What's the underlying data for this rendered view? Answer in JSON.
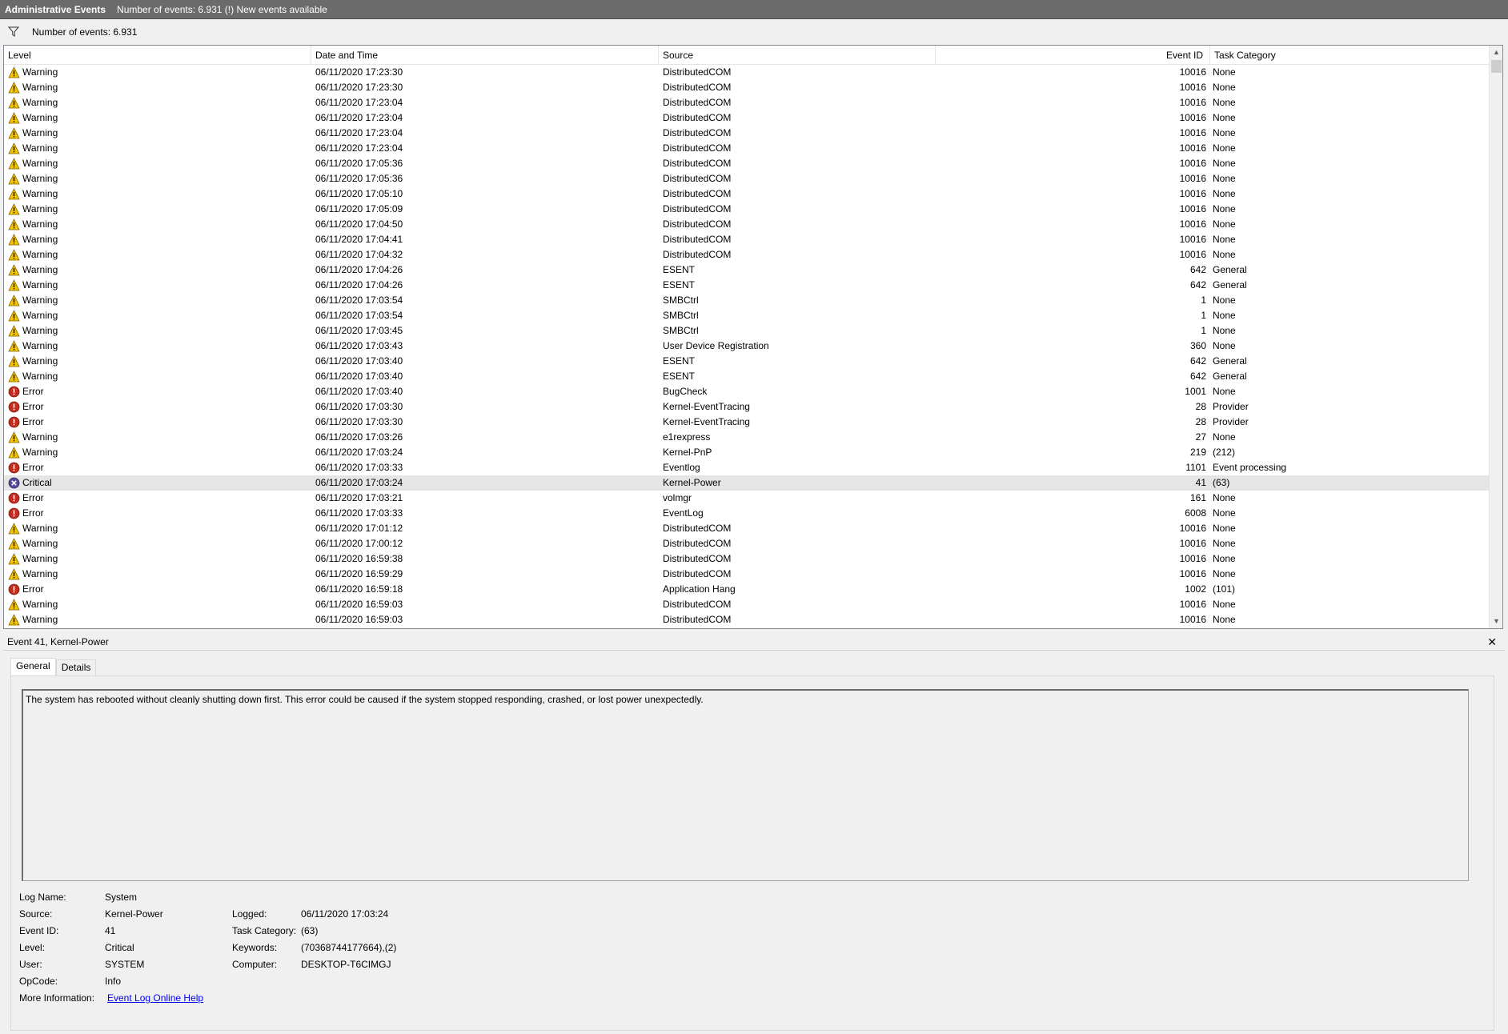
{
  "titlebar": {
    "title": "Administrative Events",
    "status": "Number of events: 6.931 (!) New events available"
  },
  "filterbar": {
    "icon": "filter-icon",
    "text": "Number of events: 6.931"
  },
  "list": {
    "columns": [
      "Level",
      "Date and Time",
      "Source",
      "Event ID",
      "Task Category"
    ],
    "rows": [
      {
        "level": "Warning",
        "date": "06/11/2020 17:23:30",
        "source": "DistributedCOM",
        "id": "10016",
        "task": "None"
      },
      {
        "level": "Warning",
        "date": "06/11/2020 17:23:30",
        "source": "DistributedCOM",
        "id": "10016",
        "task": "None"
      },
      {
        "level": "Warning",
        "date": "06/11/2020 17:23:04",
        "source": "DistributedCOM",
        "id": "10016",
        "task": "None"
      },
      {
        "level": "Warning",
        "date": "06/11/2020 17:23:04",
        "source": "DistributedCOM",
        "id": "10016",
        "task": "None"
      },
      {
        "level": "Warning",
        "date": "06/11/2020 17:23:04",
        "source": "DistributedCOM",
        "id": "10016",
        "task": "None"
      },
      {
        "level": "Warning",
        "date": "06/11/2020 17:23:04",
        "source": "DistributedCOM",
        "id": "10016",
        "task": "None"
      },
      {
        "level": "Warning",
        "date": "06/11/2020 17:05:36",
        "source": "DistributedCOM",
        "id": "10016",
        "task": "None"
      },
      {
        "level": "Warning",
        "date": "06/11/2020 17:05:36",
        "source": "DistributedCOM",
        "id": "10016",
        "task": "None"
      },
      {
        "level": "Warning",
        "date": "06/11/2020 17:05:10",
        "source": "DistributedCOM",
        "id": "10016",
        "task": "None"
      },
      {
        "level": "Warning",
        "date": "06/11/2020 17:05:09",
        "source": "DistributedCOM",
        "id": "10016",
        "task": "None"
      },
      {
        "level": "Warning",
        "date": "06/11/2020 17:04:50",
        "source": "DistributedCOM",
        "id": "10016",
        "task": "None"
      },
      {
        "level": "Warning",
        "date": "06/11/2020 17:04:41",
        "source": "DistributedCOM",
        "id": "10016",
        "task": "None"
      },
      {
        "level": "Warning",
        "date": "06/11/2020 17:04:32",
        "source": "DistributedCOM",
        "id": "10016",
        "task": "None"
      },
      {
        "level": "Warning",
        "date": "06/11/2020 17:04:26",
        "source": "ESENT",
        "id": "642",
        "task": "General"
      },
      {
        "level": "Warning",
        "date": "06/11/2020 17:04:26",
        "source": "ESENT",
        "id": "642",
        "task": "General"
      },
      {
        "level": "Warning",
        "date": "06/11/2020 17:03:54",
        "source": "SMBCtrl",
        "id": "1",
        "task": "None"
      },
      {
        "level": "Warning",
        "date": "06/11/2020 17:03:54",
        "source": "SMBCtrl",
        "id": "1",
        "task": "None"
      },
      {
        "level": "Warning",
        "date": "06/11/2020 17:03:45",
        "source": "SMBCtrl",
        "id": "1",
        "task": "None"
      },
      {
        "level": "Warning",
        "date": "06/11/2020 17:03:43",
        "source": "User Device Registration",
        "id": "360",
        "task": "None"
      },
      {
        "level": "Warning",
        "date": "06/11/2020 17:03:40",
        "source": "ESENT",
        "id": "642",
        "task": "General"
      },
      {
        "level": "Warning",
        "date": "06/11/2020 17:03:40",
        "source": "ESENT",
        "id": "642",
        "task": "General"
      },
      {
        "level": "Error",
        "date": "06/11/2020 17:03:40",
        "source": "BugCheck",
        "id": "1001",
        "task": "None"
      },
      {
        "level": "Error",
        "date": "06/11/2020 17:03:30",
        "source": "Kernel-EventTracing",
        "id": "28",
        "task": "Provider"
      },
      {
        "level": "Error",
        "date": "06/11/2020 17:03:30",
        "source": "Kernel-EventTracing",
        "id": "28",
        "task": "Provider"
      },
      {
        "level": "Warning",
        "date": "06/11/2020 17:03:26",
        "source": "e1rexpress",
        "id": "27",
        "task": "None"
      },
      {
        "level": "Warning",
        "date": "06/11/2020 17:03:24",
        "source": "Kernel-PnP",
        "id": "219",
        "task": "(212)"
      },
      {
        "level": "Error",
        "date": "06/11/2020 17:03:33",
        "source": "Eventlog",
        "id": "1101",
        "task": "Event processing"
      },
      {
        "level": "Critical",
        "date": "06/11/2020 17:03:24",
        "source": "Kernel-Power",
        "id": "41",
        "task": "(63)",
        "selected": true
      },
      {
        "level": "Error",
        "date": "06/11/2020 17:03:21",
        "source": "volmgr",
        "id": "161",
        "task": "None"
      },
      {
        "level": "Error",
        "date": "06/11/2020 17:03:33",
        "source": "EventLog",
        "id": "6008",
        "task": "None"
      },
      {
        "level": "Warning",
        "date": "06/11/2020 17:01:12",
        "source": "DistributedCOM",
        "id": "10016",
        "task": "None"
      },
      {
        "level": "Warning",
        "date": "06/11/2020 17:00:12",
        "source": "DistributedCOM",
        "id": "10016",
        "task": "None"
      },
      {
        "level": "Warning",
        "date": "06/11/2020 16:59:38",
        "source": "DistributedCOM",
        "id": "10016",
        "task": "None"
      },
      {
        "level": "Warning",
        "date": "06/11/2020 16:59:29",
        "source": "DistributedCOM",
        "id": "10016",
        "task": "None"
      },
      {
        "level": "Error",
        "date": "06/11/2020 16:59:18",
        "source": "Application Hang",
        "id": "1002",
        "task": "(101)"
      },
      {
        "level": "Warning",
        "date": "06/11/2020 16:59:03",
        "source": "DistributedCOM",
        "id": "10016",
        "task": "None"
      },
      {
        "level": "Warning",
        "date": "06/11/2020 16:59:03",
        "source": "DistributedCOM",
        "id": "10016",
        "task": "None"
      }
    ]
  },
  "detail": {
    "title": "Event 41, Kernel-Power",
    "close_icon": "close-icon",
    "tabs": [
      "General",
      "Details"
    ],
    "description": "The system has rebooted without cleanly shutting down first. This error could be caused if the system stopped responding, crashed, or lost power unexpectedly.",
    "labels": {
      "log_name": "Log Name:",
      "source": "Source:",
      "event_id": "Event ID:",
      "level": "Level:",
      "user": "User:",
      "opcode": "OpCode:",
      "more_info": "More Information:",
      "logged": "Logged:",
      "task_category": "Task Category:",
      "keywords": "Keywords:",
      "computer": "Computer:"
    },
    "values": {
      "log_name": "System",
      "source": "Kernel-Power",
      "event_id": "41",
      "level": "Critical",
      "user": "SYSTEM",
      "opcode": "Info",
      "more_info_link": "Event Log Online Help",
      "logged": "06/11/2020 17:03:24",
      "task_category": "(63)",
      "keywords": "(70368744177664),(2)",
      "computer": "DESKTOP-T6CIMGJ"
    }
  },
  "colors": {
    "warning": "#f5c400",
    "error": "#c42b1c",
    "critical": "#5b4a9b",
    "titlebar": "#6b6b6b",
    "selected_row": "#e5e5e5"
  }
}
